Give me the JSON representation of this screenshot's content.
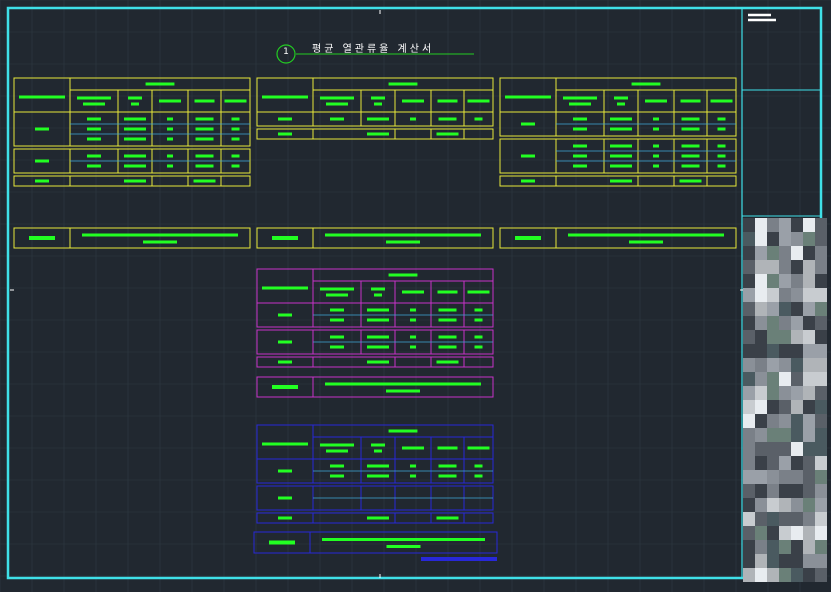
{
  "drawing": {
    "title": "평균 열관류율 계산서",
    "detail_number": "1"
  },
  "colors": {
    "background": "#212830",
    "frame": "#3fe0e8",
    "grid": "#2f3943",
    "text_bar": "#22ff22",
    "table_yellow": "#e8e83a",
    "table_magenta": "#c832c8",
    "table_blue": "#2828d8",
    "row_divider": "#3fa8d8",
    "title_line": "#22cc22",
    "title_text": "#ffffff"
  }
}
